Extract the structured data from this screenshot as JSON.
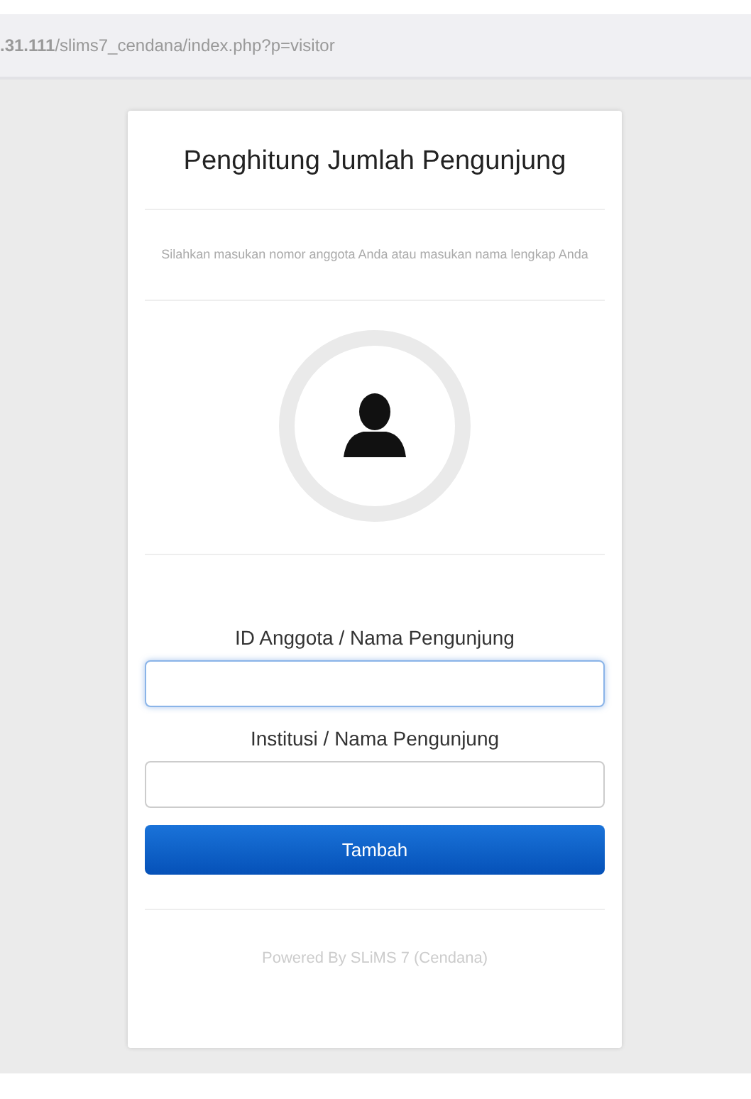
{
  "address_bar": {
    "url": "**.31.111**/slims7_cendana/index.php?p=visitor"
  },
  "card": {
    "title": "Penghitung Jumlah Pengunjung",
    "instruction": "Silahkan masukan nomor anggota Anda atau masukan nama lengkap Anda",
    "fields": [
      {
        "label": "ID Anggota / Nama Pengunjung",
        "focused": true
      },
      {
        "label": "Institusi / Nama Pengunjung",
        "focused": false
      }
    ],
    "button": "Tambah",
    "footer": "Powered By SLiMS 7 (Cendana)"
  }
}
